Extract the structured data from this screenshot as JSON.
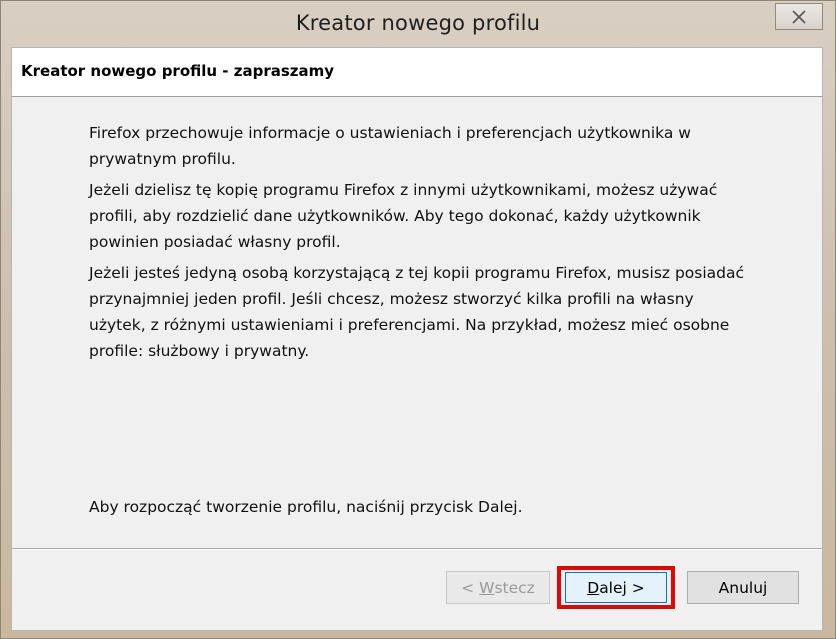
{
  "window": {
    "title": "Kreator nowego profilu"
  },
  "header": {
    "title": "Kreator nowego profilu - zapraszamy"
  },
  "content": {
    "paragraphs": [
      "Firefox przechowuje informacje o ustawieniach i preferencjach użytkownika w prywatnym profilu.",
      "Jeżeli dzielisz tę kopię programu Firefox z innymi użytkownikami, możesz używać profili, aby rozdzielić dane użytkowników. Aby tego dokonać, każdy użytkownik powinien posiadać własny profil.",
      "Jeżeli jesteś jedyną osobą korzystającą z tej kopii programu Firefox, musisz posiadać przynajmniej jeden profil. Jeśli chcesz, możesz stworzyć kilka profili na własny użytek, z różnymi ustawieniami i preferencjami. Na przykład, możesz mieć osobne profile: służbowy i prywatny."
    ],
    "footer": "Aby rozpocząć tworzenie profilu, naciśnij przycisk Dalej."
  },
  "buttons": {
    "back": {
      "prefix": "< ",
      "accel": "W",
      "rest": "stecz",
      "enabled": false
    },
    "next": {
      "accel": "D",
      "rest": "alej >",
      "enabled": true
    },
    "cancel": {
      "label": "Anuluj",
      "enabled": true
    }
  },
  "colors": {
    "highlight": "#e10600",
    "focus": "#0078d7"
  },
  "icons": {
    "close": "close-icon"
  }
}
